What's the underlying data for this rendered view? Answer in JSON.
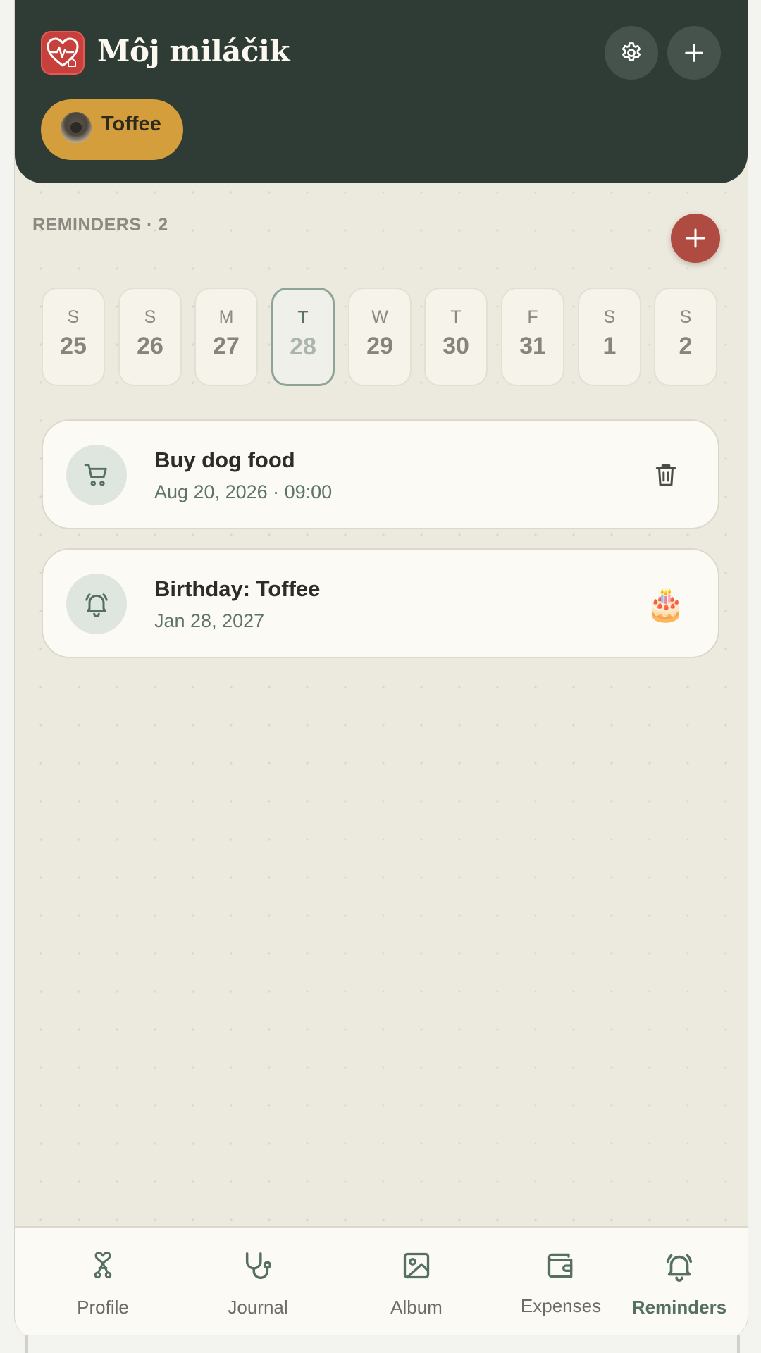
{
  "header": {
    "app_title": "Môj miláčik",
    "logo_icon": "heart-pulse-home-icon",
    "settings_icon": "gear-icon",
    "add_icon": "plus-icon",
    "pet_chip": {
      "name": "Toffee"
    }
  },
  "reminders": {
    "section_label": "REMINDERS · 2",
    "add_icon": "plus-icon",
    "days": [
      {
        "dow": "S",
        "num": "25"
      },
      {
        "dow": "S",
        "num": "26"
      },
      {
        "dow": "M",
        "num": "27"
      },
      {
        "dow": "T",
        "num": "28",
        "selected": true
      },
      {
        "dow": "W",
        "num": "29"
      },
      {
        "dow": "T",
        "num": "30"
      },
      {
        "dow": "F",
        "num": "31"
      },
      {
        "dow": "S",
        "num": "1"
      },
      {
        "dow": "S",
        "num": "2"
      }
    ],
    "items": [
      {
        "icon": "shopping-cart-icon",
        "title": "Buy dog food",
        "subtitle": "Aug 20, 2026 · 09:00",
        "action_icon": "trash-icon"
      },
      {
        "icon": "bell-icon",
        "title": "Birthday: Toffee",
        "subtitle": "Jan 28, 2027",
        "action_icon": "cake-icon",
        "action_glyph": "🎂"
      }
    ]
  },
  "nav": {
    "items": [
      {
        "label": "Profile",
        "icon": "heart-paw-icon"
      },
      {
        "label": "Journal",
        "icon": "stethoscope-icon"
      },
      {
        "label": "Album",
        "icon": "image-icon"
      },
      {
        "label": "Expenses",
        "icon": "wallet-icon"
      },
      {
        "label": "Reminders",
        "icon": "bell-ring-icon",
        "active": true
      }
    ]
  },
  "colors": {
    "header_bg": "#2f3b35",
    "pet_chip": "#d49e3d",
    "fab": "#b04b42",
    "accent_green": "#55705f",
    "logo_red": "#c8403b"
  }
}
